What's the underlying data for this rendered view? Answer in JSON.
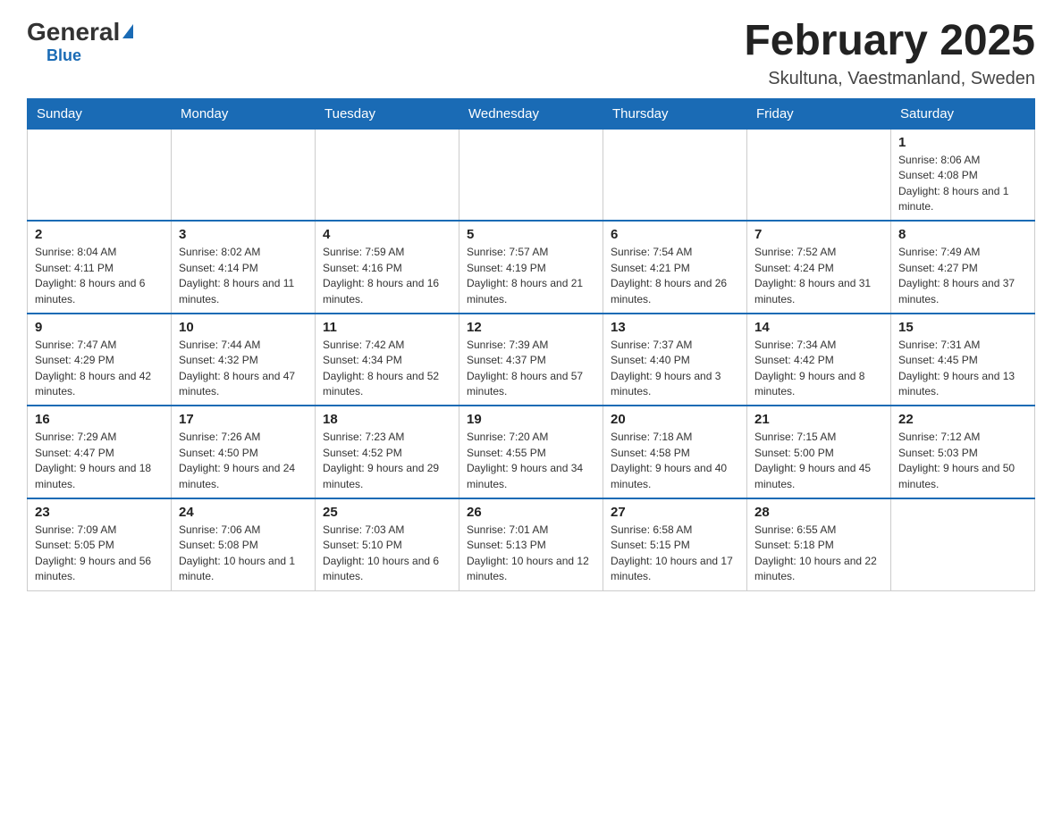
{
  "header": {
    "logo_general": "General",
    "logo_blue": "Blue",
    "month_title": "February 2025",
    "location": "Skultuna, Vaestmanland, Sweden"
  },
  "weekdays": [
    "Sunday",
    "Monday",
    "Tuesday",
    "Wednesday",
    "Thursday",
    "Friday",
    "Saturday"
  ],
  "weeks": [
    [
      {
        "day": "",
        "info": ""
      },
      {
        "day": "",
        "info": ""
      },
      {
        "day": "",
        "info": ""
      },
      {
        "day": "",
        "info": ""
      },
      {
        "day": "",
        "info": ""
      },
      {
        "day": "",
        "info": ""
      },
      {
        "day": "1",
        "info": "Sunrise: 8:06 AM\nSunset: 4:08 PM\nDaylight: 8 hours and 1 minute."
      }
    ],
    [
      {
        "day": "2",
        "info": "Sunrise: 8:04 AM\nSunset: 4:11 PM\nDaylight: 8 hours and 6 minutes."
      },
      {
        "day": "3",
        "info": "Sunrise: 8:02 AM\nSunset: 4:14 PM\nDaylight: 8 hours and 11 minutes."
      },
      {
        "day": "4",
        "info": "Sunrise: 7:59 AM\nSunset: 4:16 PM\nDaylight: 8 hours and 16 minutes."
      },
      {
        "day": "5",
        "info": "Sunrise: 7:57 AM\nSunset: 4:19 PM\nDaylight: 8 hours and 21 minutes."
      },
      {
        "day": "6",
        "info": "Sunrise: 7:54 AM\nSunset: 4:21 PM\nDaylight: 8 hours and 26 minutes."
      },
      {
        "day": "7",
        "info": "Sunrise: 7:52 AM\nSunset: 4:24 PM\nDaylight: 8 hours and 31 minutes."
      },
      {
        "day": "8",
        "info": "Sunrise: 7:49 AM\nSunset: 4:27 PM\nDaylight: 8 hours and 37 minutes."
      }
    ],
    [
      {
        "day": "9",
        "info": "Sunrise: 7:47 AM\nSunset: 4:29 PM\nDaylight: 8 hours and 42 minutes."
      },
      {
        "day": "10",
        "info": "Sunrise: 7:44 AM\nSunset: 4:32 PM\nDaylight: 8 hours and 47 minutes."
      },
      {
        "day": "11",
        "info": "Sunrise: 7:42 AM\nSunset: 4:34 PM\nDaylight: 8 hours and 52 minutes."
      },
      {
        "day": "12",
        "info": "Sunrise: 7:39 AM\nSunset: 4:37 PM\nDaylight: 8 hours and 57 minutes."
      },
      {
        "day": "13",
        "info": "Sunrise: 7:37 AM\nSunset: 4:40 PM\nDaylight: 9 hours and 3 minutes."
      },
      {
        "day": "14",
        "info": "Sunrise: 7:34 AM\nSunset: 4:42 PM\nDaylight: 9 hours and 8 minutes."
      },
      {
        "day": "15",
        "info": "Sunrise: 7:31 AM\nSunset: 4:45 PM\nDaylight: 9 hours and 13 minutes."
      }
    ],
    [
      {
        "day": "16",
        "info": "Sunrise: 7:29 AM\nSunset: 4:47 PM\nDaylight: 9 hours and 18 minutes."
      },
      {
        "day": "17",
        "info": "Sunrise: 7:26 AM\nSunset: 4:50 PM\nDaylight: 9 hours and 24 minutes."
      },
      {
        "day": "18",
        "info": "Sunrise: 7:23 AM\nSunset: 4:52 PM\nDaylight: 9 hours and 29 minutes."
      },
      {
        "day": "19",
        "info": "Sunrise: 7:20 AM\nSunset: 4:55 PM\nDaylight: 9 hours and 34 minutes."
      },
      {
        "day": "20",
        "info": "Sunrise: 7:18 AM\nSunset: 4:58 PM\nDaylight: 9 hours and 40 minutes."
      },
      {
        "day": "21",
        "info": "Sunrise: 7:15 AM\nSunset: 5:00 PM\nDaylight: 9 hours and 45 minutes."
      },
      {
        "day": "22",
        "info": "Sunrise: 7:12 AM\nSunset: 5:03 PM\nDaylight: 9 hours and 50 minutes."
      }
    ],
    [
      {
        "day": "23",
        "info": "Sunrise: 7:09 AM\nSunset: 5:05 PM\nDaylight: 9 hours and 56 minutes."
      },
      {
        "day": "24",
        "info": "Sunrise: 7:06 AM\nSunset: 5:08 PM\nDaylight: 10 hours and 1 minute."
      },
      {
        "day": "25",
        "info": "Sunrise: 7:03 AM\nSunset: 5:10 PM\nDaylight: 10 hours and 6 minutes."
      },
      {
        "day": "26",
        "info": "Sunrise: 7:01 AM\nSunset: 5:13 PM\nDaylight: 10 hours and 12 minutes."
      },
      {
        "day": "27",
        "info": "Sunrise: 6:58 AM\nSunset: 5:15 PM\nDaylight: 10 hours and 17 minutes."
      },
      {
        "day": "28",
        "info": "Sunrise: 6:55 AM\nSunset: 5:18 PM\nDaylight: 10 hours and 22 minutes."
      },
      {
        "day": "",
        "info": ""
      }
    ]
  ]
}
